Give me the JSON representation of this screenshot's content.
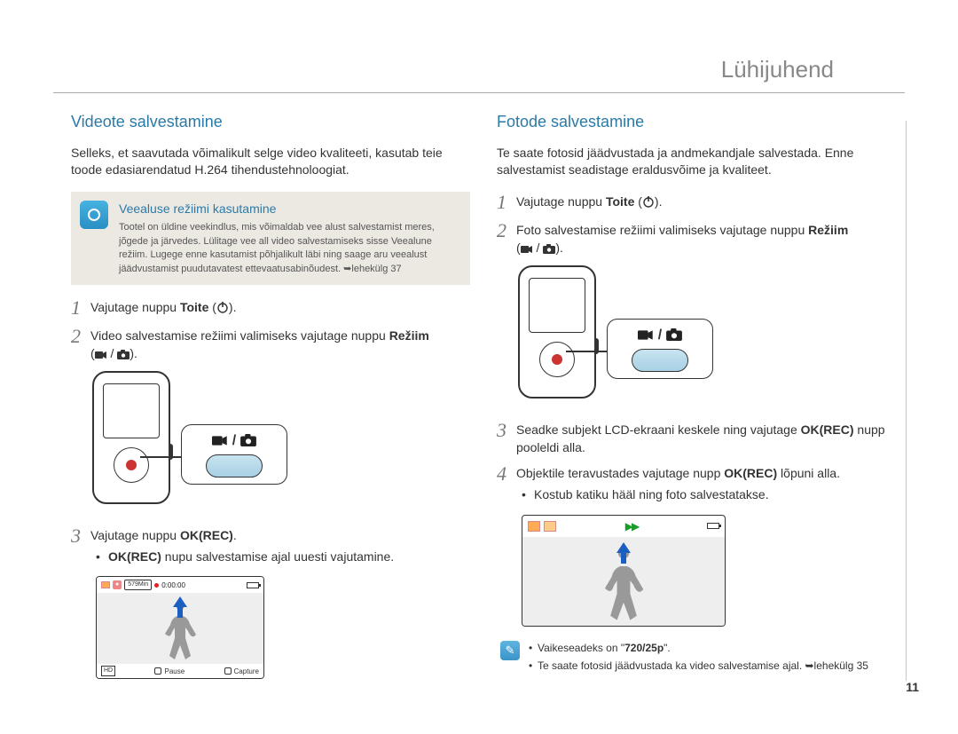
{
  "header": {
    "title": "Lühijuhend"
  },
  "page_number": "11",
  "left": {
    "title": "Videote salvestamine",
    "intro": "Selleks, et saavutada võimalikult selge video kvaliteeti, kasutab teie toode edasiarendatud H.264 tihendustehnoloogiat.",
    "note": {
      "title": "Veealuse režiimi kasutamine",
      "body": "Tootel on üldine veekindlus, mis võimaldab vee alust salvestamist meres, jõgede ja järvedes. Lülitage vee all video salvestamiseks sisse Veealune režiim. Lugege enne kasutamist põhjalikult läbi ning saage aru veealust jäädvustamist puudutavatest ettevaatusabinõudest. ➥lehekülg 37"
    },
    "steps": {
      "s1_pre": "Vajutage nuppu ",
      "s1_bold": "Toite",
      "s1_post": " (",
      "s1_close": ").",
      "s2_pre": "Video salvestamise režiimi valimiseks vajutage nuppu ",
      "s2_bold": "Režiim",
      "s2_line2_pre": "(",
      "s2_line2_post": ").",
      "s3_pre": "Vajutage nuppu ",
      "s3_bold": "OK(REC)",
      "s3_post": ".",
      "s3_bullet_bold": "OK(REC)",
      "s3_bullet_rest": " nupu salvestamise ajal uuesti vajutamine."
    },
    "lcd": {
      "min_label": "579Min",
      "time": "0:00:00",
      "hd": "HD",
      "pause": "Pause",
      "capture": "Capture"
    },
    "callout_mode": "🎥/📷"
  },
  "right": {
    "title": "Fotode salvestamine",
    "intro": "Te saate fotosid jäädvustada ja andmekandjale salvestada. Enne salvestamist seadistage eraldusvõime ja kvaliteet.",
    "steps": {
      "s1_pre": "Vajutage nuppu ",
      "s1_bold": "Toite",
      "s1_post": " (",
      "s1_close": ").",
      "s2_pre": "Foto salvestamise režiimi valimiseks vajutage nuppu ",
      "s2_bold": "Režiim",
      "s2_line2_pre": "(",
      "s2_line2_post": ").",
      "s3_pre": "Seadke subjekt LCD-ekraani keskele ning vajutage ",
      "s3_bold": "OK(REC)",
      "s3_post": " nupp pooleldi alla.",
      "s4_pre": "Objektile teravustades vajutage nupp ",
      "s4_bold": "OK(REC)",
      "s4_post": " lõpuni alla.",
      "s4_bullet": "Kostub katiku hääl ning foto salvestatakse."
    },
    "info": {
      "l1_pre": "Vaikeseadeks on \"",
      "l1_bold": "720/25p",
      "l1_post": "\".",
      "l2": "Te saate fotosid jäädvustada ka video salvestamise ajal. ➥lehekülg 35"
    }
  }
}
